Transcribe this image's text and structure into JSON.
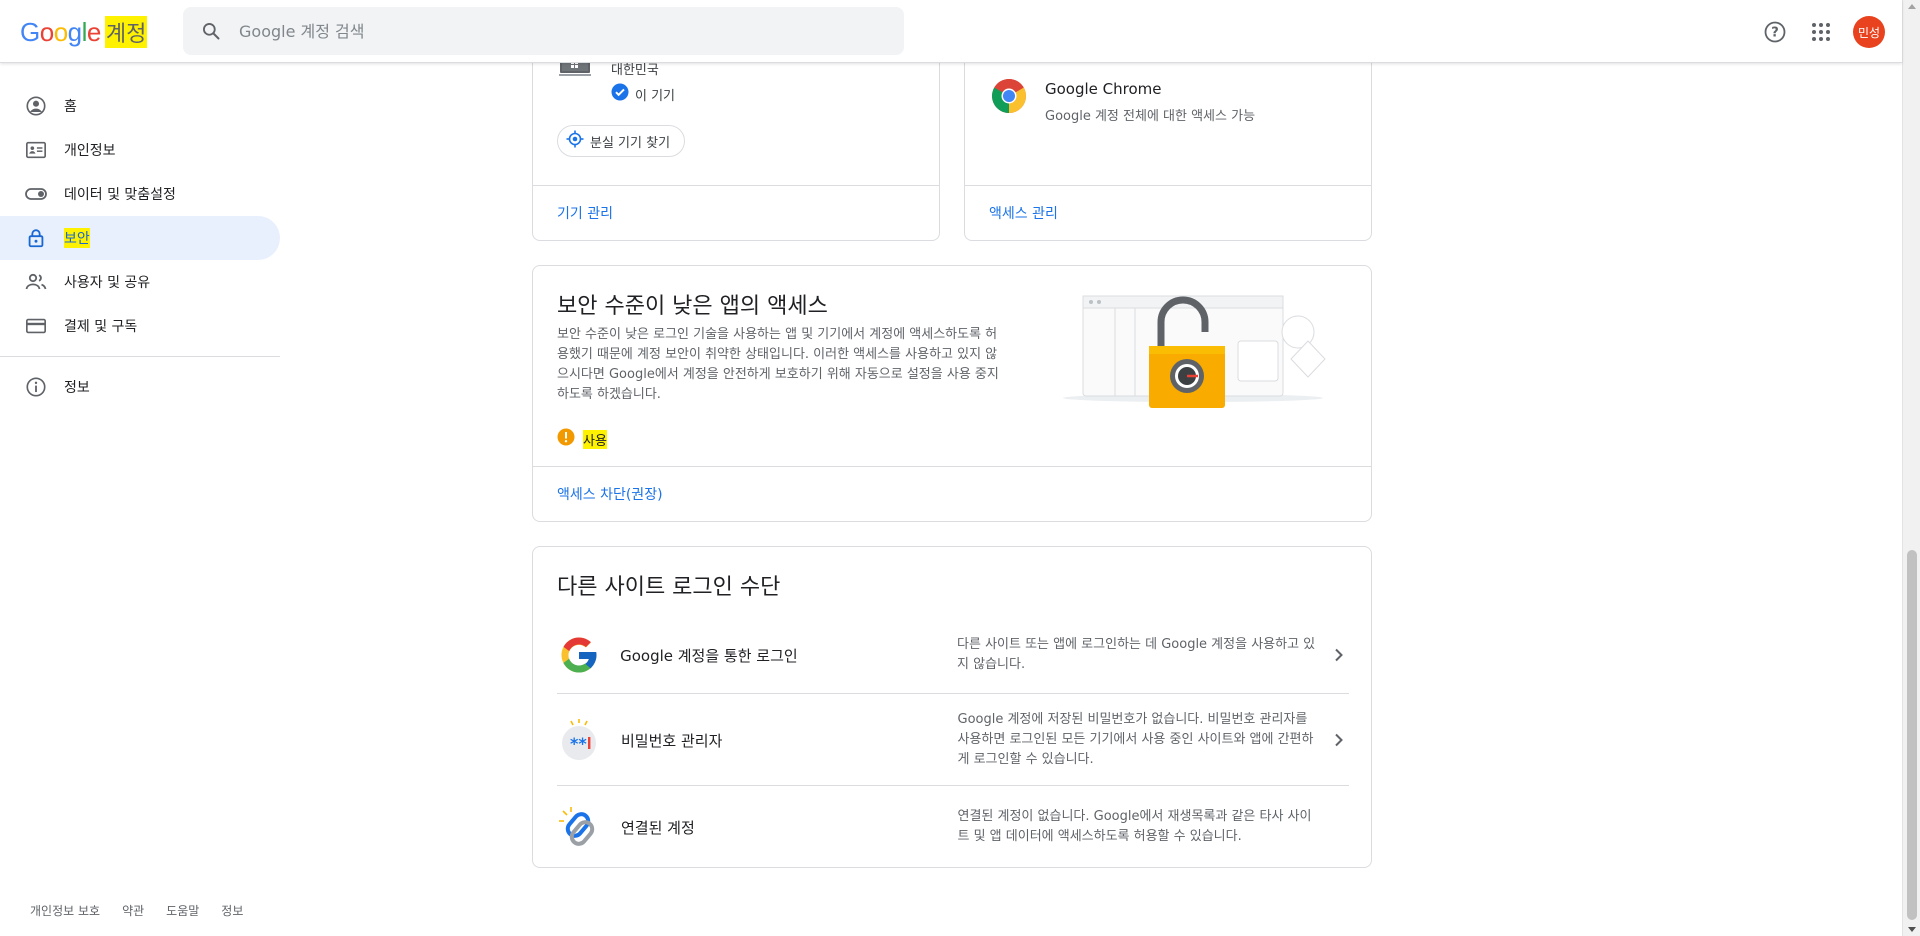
{
  "header": {
    "logo_google": [
      "G",
      "o",
      "o",
      "g",
      "l",
      "e"
    ],
    "logo_product": "계정",
    "search_placeholder": "Google 계정 검색",
    "avatar_text": "민성",
    "help_icon": "help-icon",
    "apps_icon": "apps-grid-icon"
  },
  "sidebar": {
    "items": [
      {
        "label": "홈",
        "icon": "account-circle-icon"
      },
      {
        "label": "개인정보",
        "icon": "id-card-icon"
      },
      {
        "label": "데이터 및 맞춤설정",
        "icon": "toggle-icon"
      },
      {
        "label": "보안",
        "icon": "lock-icon",
        "active": true
      },
      {
        "label": "사용자 및 공유",
        "icon": "people-icon"
      },
      {
        "label": "결제 및 구독",
        "icon": "credit-card-icon"
      }
    ],
    "info_item": {
      "label": "정보",
      "icon": "info-icon"
    }
  },
  "footer": {
    "links": [
      "개인정보 보호",
      "약관",
      "도움말",
      "정보"
    ]
  },
  "devices_card": {
    "country": "대한민국",
    "this_device": "이 기기",
    "find_button": "분실 기기 찾기",
    "manage_link": "기기 관리"
  },
  "apps_card": {
    "app_name": "Google Chrome",
    "app_desc": "Google 계정 전체에 대한 액세스 가능",
    "manage_link": "액세스 관리"
  },
  "less_secure": {
    "title": "보안 수준이 낮은 앱의 액세스",
    "body": "보안 수준이 낮은 로그인 기술을 사용하는 앱 및 기기에서 계정에 액세스하도록 허용했기 때문에 계정 보안이 취약한 상태입니다. 이러한 액세스를 사용하고 있지 않으시다면 Google에서 계정을 안전하게 보호하기 위해 자동으로 설정을 사용 중지하도록 하겠습니다.",
    "status": "사용",
    "action_link": "액세스 차단(권장)"
  },
  "signin_other": {
    "title": "다른 사이트 로그인 수단",
    "rows": [
      {
        "name": "Google 계정을 통한 로그인",
        "desc": "다른 사이트 또는 앱에 로그인하는 데 Google 계정을 사용하고 있지 않습니다."
      },
      {
        "name": "비밀번호 관리자",
        "desc": "Google 계정에 저장된 비밀번호가 없습니다. 비밀번호 관리자를 사용하면 로그인된 모든 기기에서 사용 중인 사이트와 앱에 간편하게 로그인할 수 있습니다."
      },
      {
        "name": "연결된 계정",
        "desc": "연결된 계정이 없습니다. Google에서 재생목록과 같은 타사 사이트 및 앱 데이터에 액세스하도록 허용할 수 있습니다."
      }
    ]
  },
  "colors": {
    "accent": "#1a73e8",
    "active_bg": "#e8f0fe",
    "warning": "#f29900",
    "avatar_bg": "#e8431e",
    "highlight": "#fff200"
  }
}
